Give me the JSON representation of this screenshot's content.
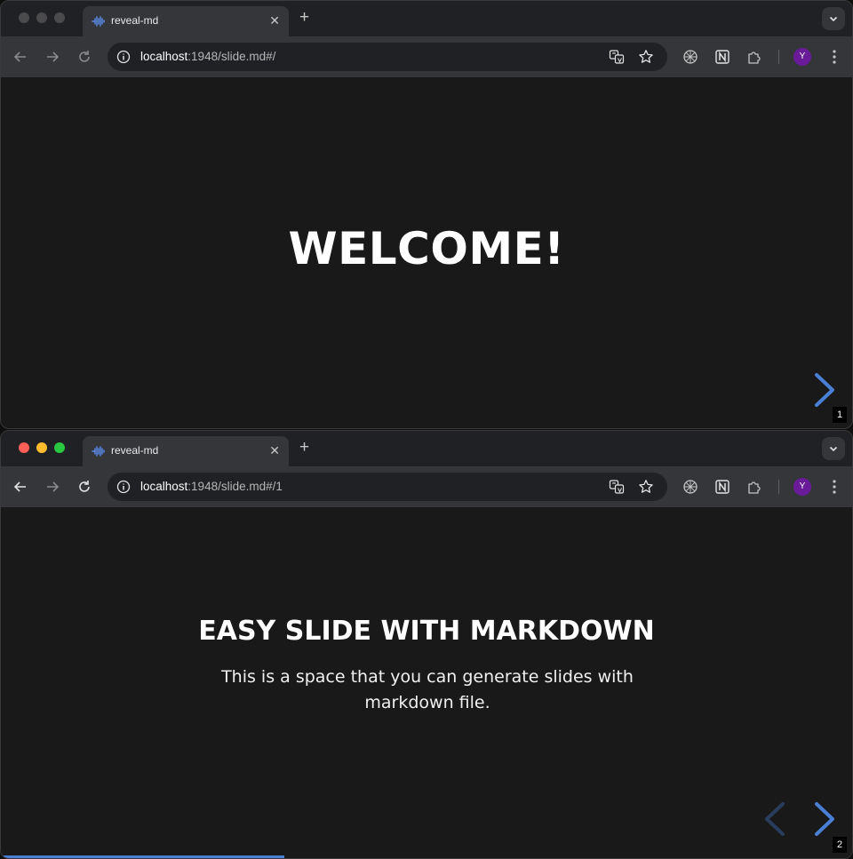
{
  "windows": [
    {
      "tab_title": "reveal-md",
      "url_host": "localhost",
      "url_path": ":1948/slide.md#/",
      "slide": {
        "heading": "WELCOME!"
      },
      "slide_number": "1",
      "controls": {
        "prev_visible": false,
        "next_visible": true
      },
      "traffic_lights_active": false
    },
    {
      "tab_title": "reveal-md",
      "url_host": "localhost",
      "url_path": ":1948/slide.md#/1",
      "slide": {
        "heading": "EASY SLIDE WITH MARKDOWN",
        "body_line_1": "This is a space that you can generate slides with",
        "body_line_2": "markdown file."
      },
      "slide_number": "2",
      "controls": {
        "prev_visible": true,
        "next_visible": true
      },
      "progress_fraction": 0.333,
      "traffic_lights_active": true
    }
  ],
  "profile_initial": "Y",
  "colors": {
    "accent": "#4a7fd6",
    "profile": "#6a1b9a",
    "slide_bg": "#191919"
  }
}
